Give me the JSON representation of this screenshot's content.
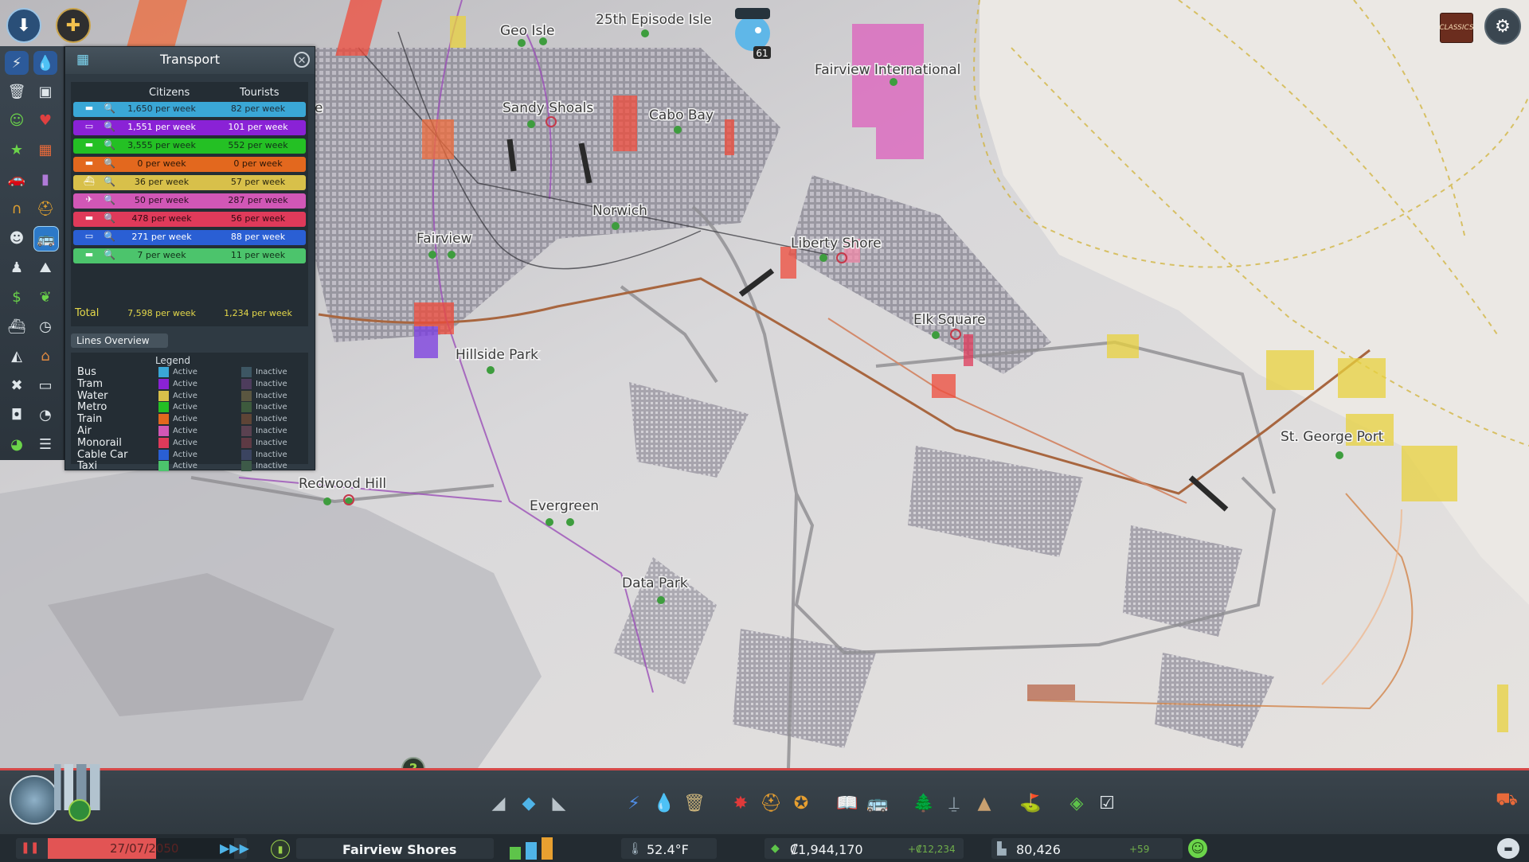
{
  "map": {
    "districts": [
      {
        "name": "Geo Isle"
      },
      {
        "name": "25th Episode Isle"
      },
      {
        "name": "Fairview International"
      },
      {
        "name": "Sandy Shoals"
      },
      {
        "name": "Cabo Bay"
      },
      {
        "name": "Norwich"
      },
      {
        "name": "Fairview"
      },
      {
        "name": "Liberty Shore"
      },
      {
        "name": "Elk Square"
      },
      {
        "name": "Hillside Park"
      },
      {
        "name": "St. George Port"
      },
      {
        "name": "Redwood Hill"
      },
      {
        "name": "Evergreen"
      },
      {
        "name": "Data Park"
      },
      {
        "name": "e"
      }
    ],
    "chirper_count": "61"
  },
  "top_right": {
    "radio_label": "CLASSICS"
  },
  "panel": {
    "title": "Transport",
    "col_citizens": "Citizens",
    "col_tourists": "Tourists",
    "rows": [
      {
        "mode": "Bus",
        "citizens": "1,650 per week",
        "tourists": "82 per week",
        "color": "#3aa7d6",
        "text": "#1d2a34"
      },
      {
        "mode": "Tram",
        "citizens": "1,551 per week",
        "tourists": "101 per week",
        "color": "#8a22d6",
        "text": "#ffffff"
      },
      {
        "mode": "Metro",
        "citizens": "3,555 per week",
        "tourists": "552 per week",
        "color": "#24c024",
        "text": "#12301a"
      },
      {
        "mode": "Train",
        "citizens": "0 per week",
        "tourists": "0 per week",
        "color": "#e3681e",
        "text": "#2a1607"
      },
      {
        "mode": "Water",
        "citizens": "36 per week",
        "tourists": "57 per week",
        "color": "#d8c04a",
        "text": "#2a2610"
      },
      {
        "mode": "Air",
        "citizens": "50 per week",
        "tourists": "287 per week",
        "color": "#d157b6",
        "text": "#2b0f24"
      },
      {
        "mode": "Monorail",
        "citizens": "478 per week",
        "tourists": "56 per week",
        "color": "#df3a5a",
        "text": "#2d0a12"
      },
      {
        "mode": "Cable Car",
        "citizens": "271 per week",
        "tourists": "88 per week",
        "color": "#2a5fd4",
        "text": "#ffffff"
      },
      {
        "mode": "Taxi",
        "citizens": "7 per week",
        "tourists": "11 per week",
        "color": "#4cc46c",
        "text": "#12301a"
      }
    ],
    "total_label": "Total",
    "total_citizens": "7,598 per week",
    "total_tourists": "1,234 per week",
    "lines_overview": "Lines Overview",
    "legend_title": "Legend",
    "active_label": "Active",
    "inactive_label": "Inactive",
    "legend": [
      {
        "name": "Bus",
        "active": "#3aa7d6",
        "inactive": "#3d5663"
      },
      {
        "name": "Tram",
        "active": "#8a22d6",
        "inactive": "#4d3c5c"
      },
      {
        "name": "Water",
        "active": "#d8c04a",
        "inactive": "#5a5640"
      },
      {
        "name": "Metro",
        "active": "#24c024",
        "inactive": "#3d5a3d"
      },
      {
        "name": "Train",
        "active": "#e3681e",
        "inactive": "#5e4436"
      },
      {
        "name": "Air",
        "active": "#d157b6",
        "inactive": "#5a4150"
      },
      {
        "name": "Monorail",
        "active": "#df3a5a",
        "inactive": "#5e3a44"
      },
      {
        "name": "Cable Car",
        "active": "#2a5fd4",
        "inactive": "#3b4460"
      },
      {
        "name": "Taxi",
        "active": "#4cc46c",
        "inactive": "#3d5a48"
      }
    ]
  },
  "bottom": {
    "date": "27/07/2050",
    "city_name": "Fairview Shores",
    "temperature": "52.4°F",
    "money": "₡1,944,170",
    "money_delta": "+₡12,234",
    "population": "80,426",
    "population_delta": "+59"
  }
}
